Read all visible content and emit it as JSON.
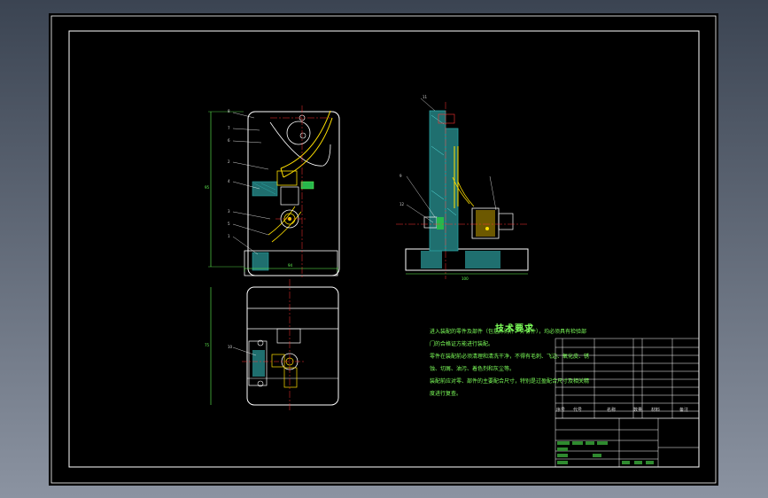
{
  "drawing": {
    "technical_requirements": {
      "title": "技术要求",
      "items": [
        "进入装配的零件及部件（包括外购件、外协件），均必须具有检验部",
        "门的合格证方能进行装配。",
        "零件在装配前必须清理和清洗干净，不得有毛刺、飞边、氧化皮、锈",
        "蚀、切屑、油污、着色剂和灰尘等。",
        "装配前应对零、部件的主要配合尺寸，特别是过盈配合尺寸及相关精",
        "度进行复查。"
      ]
    },
    "title_block_labels": {
      "seq": "序号",
      "code": "代号",
      "name": "名称",
      "qty": "数量",
      "material": "材料",
      "remark": "备注"
    },
    "part_labels": [
      "1",
      "2",
      "3",
      "4",
      "5",
      "6",
      "7",
      "8",
      "9",
      "10",
      "11",
      "12"
    ],
    "colors": {
      "outline": "#ffffff",
      "dimension": "#66ff55",
      "centerline": "#ff3333",
      "hatch": "#2aa6a6",
      "yellow": "#ffe000",
      "requirements_text": "#7dff5a"
    }
  }
}
